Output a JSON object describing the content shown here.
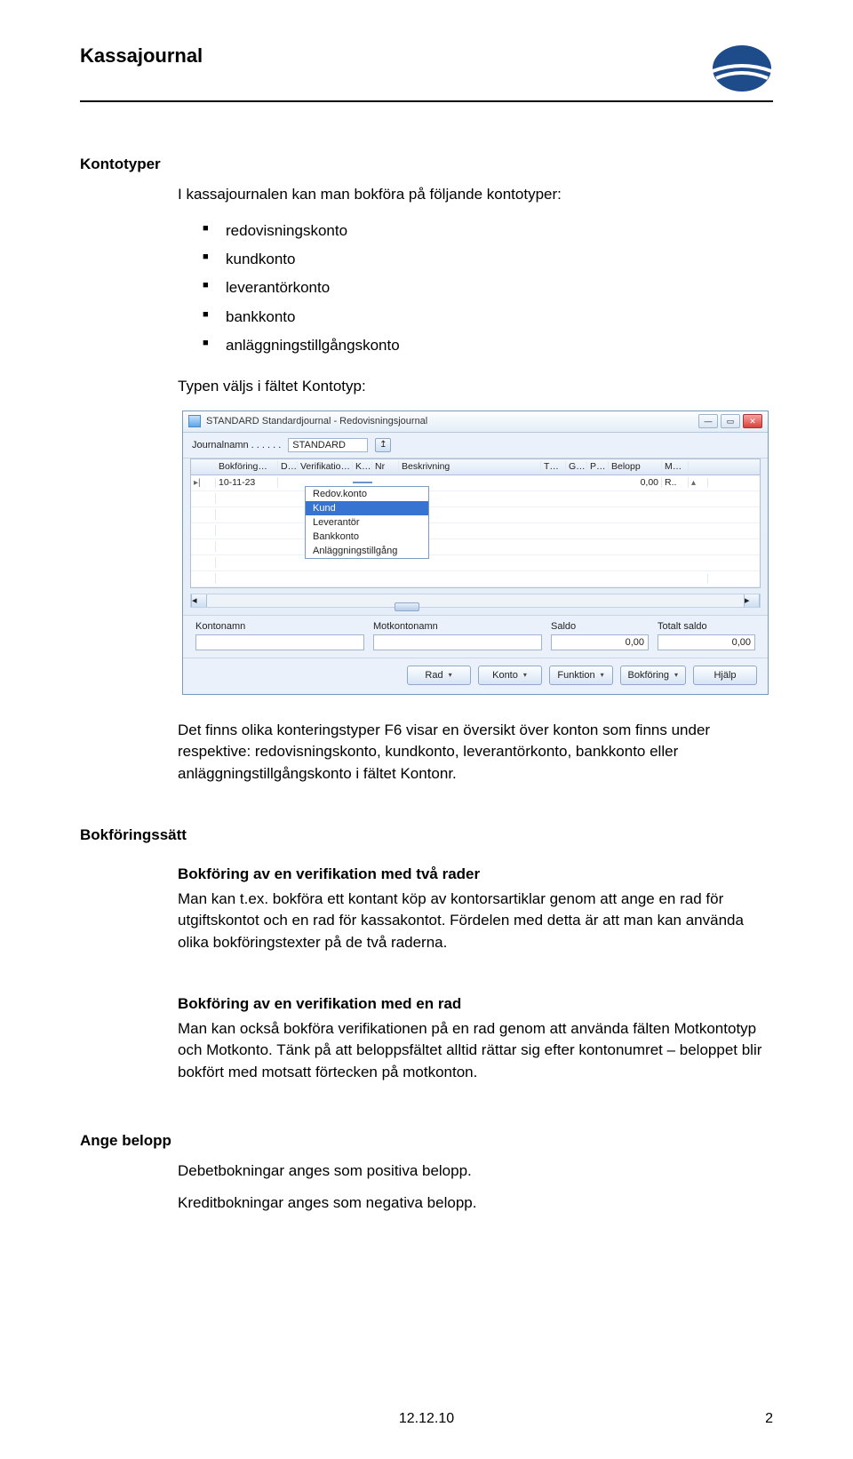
{
  "page": {
    "title": "Kassajournal",
    "footer_date": "12.12.10",
    "page_number": "2"
  },
  "sec1": {
    "heading": "Kontotyper",
    "intro": "I kassajournalen kan man bokföra på följande kontotyper:",
    "bullets": [
      "redovisningskonto",
      "kundkonto",
      "leverantörkonto",
      "bankkonto",
      "anläggningstillgångskonto"
    ],
    "after_img": "Typen väljs i fältet Kontotyp:"
  },
  "window": {
    "title": "STANDARD Standardjournal - Redovisningsjournal",
    "jn_label": "Journalnamn . . . . . .",
    "jn_value": "STANDARD",
    "cols": [
      "",
      "Bokföring…",
      "D…",
      "Verifikatio…",
      "K…",
      "Nr",
      "Beskrivning",
      "T…",
      "G…",
      "P…",
      "Belopp",
      "M…",
      ""
    ],
    "row1_date": "10-11-23",
    "row1_belopp": "0,00",
    "row1_m": "R..",
    "dd": [
      "Redov.konto",
      "Kund",
      "Leverantör",
      "Bankkonto",
      "Anläggningstillgång"
    ],
    "bf_labels": [
      "Kontonamn",
      "Motkontonamn",
      "Saldo",
      "Totalt saldo"
    ],
    "saldo": "0,00",
    "totalt": "0,00",
    "buttons": [
      "Rad",
      "Konto",
      "Funktion",
      "Bokföring",
      "Hjälp"
    ]
  },
  "sec2": {
    "para": "Det finns olika konteringstyper F6 visar en översikt över konton som finns under respektive: redovisningskonto, kundkonto, leverantörkonto, bankkonto eller anläggningstillgångskonto i fältet Kontonr."
  },
  "sec3": {
    "heading": "Bokföringssätt",
    "h1": "Bokföring av en verifikation med två rader",
    "p1": "Man kan t.ex. bokföra ett kontant köp av kontorsartiklar genom att ange en rad för utgiftskontot och en rad för kassakontot. Fördelen med detta är att man kan använda olika bokföringstexter på de två raderna.",
    "h2": "Bokföring av en verifikation med en rad",
    "p2": "Man kan också bokföra verifikationen på en rad genom att använda fälten Motkontotyp och Motkonto. Tänk på att beloppsfältet alltid rättar sig efter kontonumret – beloppet blir bokfört med motsatt förtecken på motkonton."
  },
  "sec4": {
    "heading": "Ange belopp",
    "p1": "Debetbokningar anges som positiva belopp.",
    "p2": "Kreditbokningar anges som negativa belopp."
  }
}
